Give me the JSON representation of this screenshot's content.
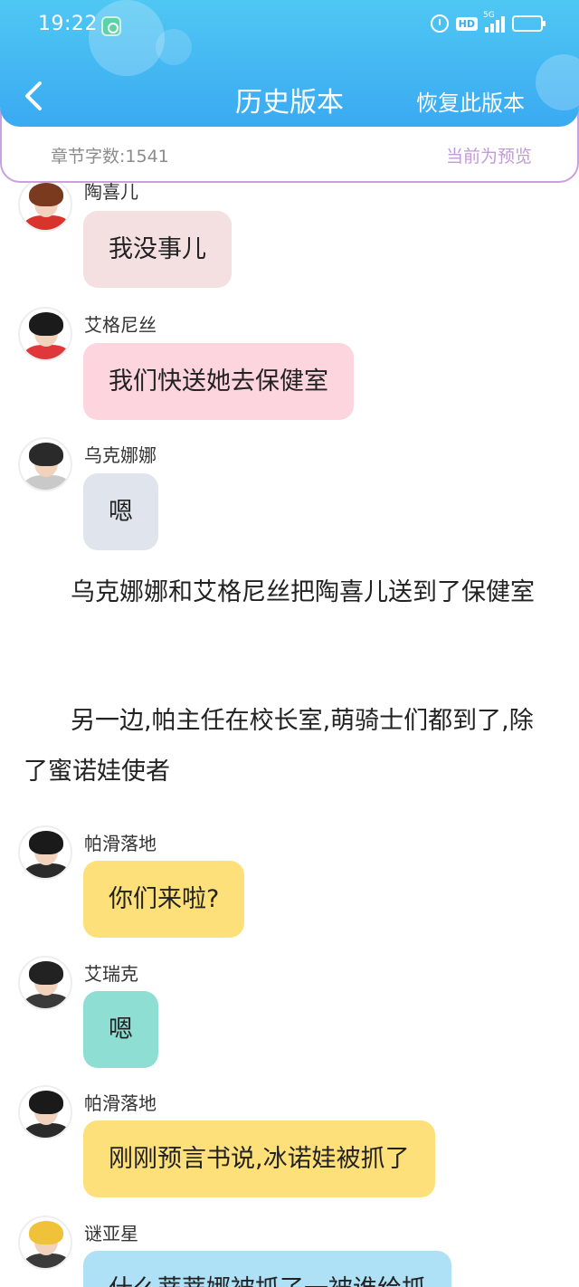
{
  "status_bar": {
    "time": "19:22",
    "hd": "HD",
    "network": "5G"
  },
  "nav": {
    "title": "历史版本",
    "restore": "恢复此版本"
  },
  "info": {
    "word_count": "章节字数:1541",
    "preview": "当前为预览"
  },
  "messages": [
    {
      "speaker": "陶喜儿",
      "text": "我没事儿",
      "bubble_color": "#f4dfe1",
      "avatar_hair": "#7a3a1e",
      "avatar_body": "#d8342c"
    },
    {
      "speaker": "艾格尼丝",
      "text": "我们快送她去保健室",
      "bubble_color": "#fdd5df",
      "avatar_hair": "#1b1b1b",
      "avatar_body": "#e0373a"
    },
    {
      "speaker": "乌克娜娜",
      "text": "嗯",
      "bubble_color": "#dfe4ed",
      "avatar_hair": "#2a2a2a",
      "avatar_body": "#c9c9c9"
    },
    {
      "speaker": "帕滑落地",
      "text": "你们来啦?",
      "bubble_color": "#fde07a",
      "avatar_hair": "#1a1a1a",
      "avatar_body": "#2a2a2a"
    },
    {
      "speaker": "艾瑞克",
      "text": "嗯",
      "bubble_color": "#8fded4",
      "avatar_hair": "#222222",
      "avatar_body": "#3a3a3a"
    },
    {
      "speaker": "帕滑落地",
      "text": "刚刚预言书说,冰诺娃被抓了",
      "bubble_color": "#fde07a",
      "avatar_hair": "#1a1a1a",
      "avatar_body": "#2a2a2a"
    },
    {
      "speaker": "谜亚星",
      "text": "什么蒂蒂娜被抓了一被谁给抓",
      "bubble_color": "#aee0f6",
      "avatar_hair": "#f0c23a",
      "avatar_body": "#3a3a3a"
    }
  ],
  "narrations": [
    "乌克娜娜和艾格尼丝把陶喜儿送到了保健室",
    "另一边,帕主任在校长室,萌骑士们都到了,除了蜜诺娃使者"
  ]
}
